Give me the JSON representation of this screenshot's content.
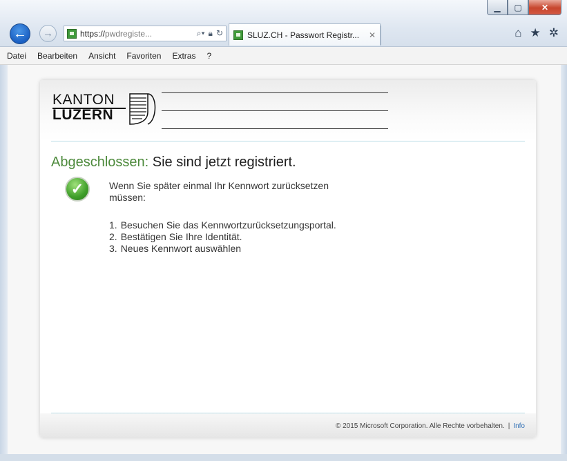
{
  "browser": {
    "address": {
      "scheme": "https://",
      "rest": "pwdregiste..."
    },
    "tab_title": "SLUZ.CH - Passwort Registr...",
    "tab_close": "✕"
  },
  "menubar": {
    "items": [
      "Datei",
      "Bearbeiten",
      "Ansicht",
      "Favoriten",
      "Extras",
      "?"
    ]
  },
  "page": {
    "logo": {
      "line1": "KANTON",
      "line2": "LUZERN"
    },
    "heading_status": "Abgeschlossen:",
    "heading_text": "Sie sind jetzt registriert.",
    "intro": "Wenn Sie später einmal Ihr Kennwort zurücksetzen müssen:",
    "steps": [
      {
        "num": "1.",
        "text": "Besuchen Sie das Kennwortzurücksetzungsportal."
      },
      {
        "num": "2.",
        "text": "Bestätigen Sie Ihre Identität."
      },
      {
        "num": "3.",
        "text": "Neues Kennwort auswählen"
      }
    ],
    "footer": {
      "copyright": "© 2015 Microsoft Corporation. Alle Rechte vorbehalten.",
      "separator": "|",
      "info_link": "Info"
    }
  },
  "icons": {
    "back": "back-arrow-icon",
    "forward": "forward-arrow-icon",
    "search": "search-icon",
    "lock": "lock-icon",
    "refresh": "refresh-icon",
    "home": "home-icon",
    "favorites": "star-icon",
    "tools": "gear-icon",
    "success": "checkmark-icon"
  },
  "colors": {
    "status_green": "#4d8a3c",
    "link_blue": "#2f6fb5",
    "separator": "#b8dbe6"
  }
}
